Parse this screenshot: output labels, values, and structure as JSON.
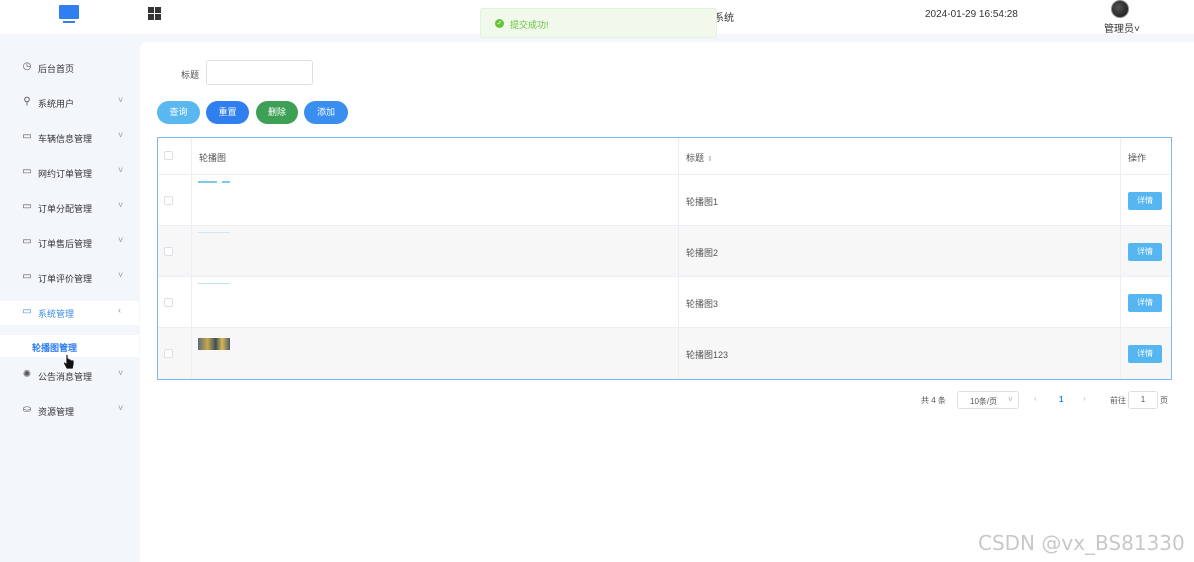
{
  "header": {
    "title_fragment": "系统",
    "datetime": "2024-01-29 16:54:28",
    "user": "管理员",
    "user_arrow": "˅"
  },
  "toast": {
    "message": "提交成功!",
    "icon": "check-circle-icon",
    "color": "#67c23a"
  },
  "sidebar": {
    "items": [
      {
        "label": "后台首页",
        "icon": "◷"
      },
      {
        "label": "系统用户",
        "icon": "⚲",
        "arrow": "˅"
      },
      {
        "label": "车辆信息管理",
        "icon": "▭",
        "arrow": "˅"
      },
      {
        "label": "网约订单管理",
        "icon": "▭",
        "arrow": "˅"
      },
      {
        "label": "订单分配管理",
        "icon": "▭",
        "arrow": "˅"
      },
      {
        "label": "订单售后管理",
        "icon": "▭",
        "arrow": "˅"
      },
      {
        "label": "订单评价管理",
        "icon": "▭",
        "arrow": "˅"
      },
      {
        "label": "系统管理",
        "icon": "▭",
        "arrow": "‹"
      },
      {
        "label": "公告消息管理",
        "icon": "✺",
        "arrow": "˅"
      },
      {
        "label": "资源管理",
        "icon": "⛀",
        "arrow": "˅"
      }
    ],
    "submenu": {
      "label": "轮播图管理"
    }
  },
  "search": {
    "label": "标题",
    "value": "",
    "placeholder": ""
  },
  "toolbar": {
    "query": "查询",
    "reset": "重置",
    "delete": "删除",
    "add": "添加"
  },
  "table": {
    "headers": {
      "image": "轮播图",
      "title": "标题",
      "sort": "⇕",
      "actions": "操作"
    },
    "rows": [
      {
        "title": "轮播图1",
        "action": "详情"
      },
      {
        "title": "轮播图2",
        "action": "详情"
      },
      {
        "title": "轮播图3",
        "action": "详情"
      },
      {
        "title": "轮播图123",
        "action": "详情"
      }
    ]
  },
  "pagination": {
    "total": "共 4 条",
    "page_size": "10条/页",
    "size_arrow": "˅",
    "prev": "‹",
    "current_page": "1",
    "next": "›",
    "goto_label": "前往",
    "goto_value": "1",
    "goto_unit": "页"
  },
  "watermark": "CSDN @vx_BS81330",
  "colors": {
    "primary": "#2f7ff0",
    "query": "#5ab8f0",
    "delete": "#3ea055",
    "sidebar_bg": "#f3f6fb"
  }
}
